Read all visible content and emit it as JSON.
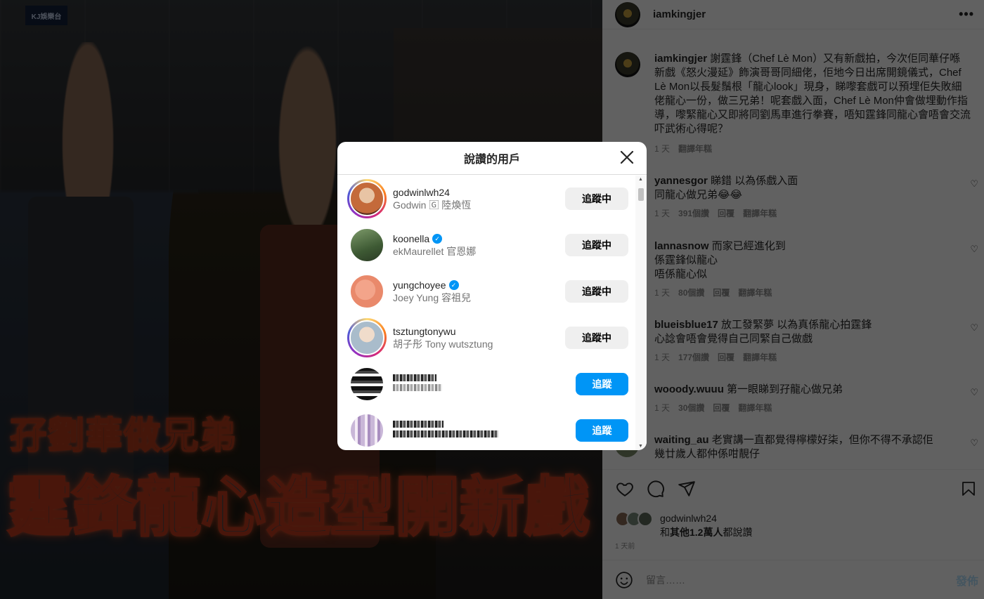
{
  "post": {
    "watermark": "KJ娛樂台",
    "headline_line1": "孖劉華做兄弟",
    "headline_line2": "霆鋒龍心造型開新戲"
  },
  "panel": {
    "author": "iamkingjer",
    "more_icon": "more-horizontal-icon",
    "caption": {
      "username": "iamkingjer",
      "text": "謝霆鋒（Chef Lè Mon）又有新戲拍，今次佢同華仔喺新戲《怒火漫延》飾演哥哥同細佬，佢地今日出席開鏡儀式，Chef Lè Mon以長髮鬚根「龍心look」現身，睇嚟套戲可以預埋佢失敗細佬龍心一份，做三兄弟！呢套戲入面，Chef Lè Mon仲會做埋動作指導，嚟緊龍心又即將同劉馬車進行拳賽，唔知霆鋒同龍心會唔會交流吓武術心得呢？",
      "time": "1 天",
      "translate": "翻譯年糕"
    },
    "comments": [
      {
        "user": "yannesgor",
        "text": "睇錯 以為係戲入面",
        "text2": "同龍心做兄弟😂😂",
        "time": "1 天",
        "likes": "391個讚",
        "reply": "回覆",
        "translate": "翻譯年糕"
      },
      {
        "user": "lannasnow",
        "text": "而家已經進化到",
        "text2": "係霆鋒似龍心",
        "text3": "唔係龍心似",
        "time": "1 天",
        "likes": "80個讚",
        "reply": "回覆",
        "translate": "翻譯年糕"
      },
      {
        "user": "blueisblue17",
        "text": "放工發緊夢 以為真係龍心拍霆鋒",
        "text2": "心諗會唔會覺得自己同緊自己做戲",
        "time": "1 天",
        "likes": "177個讚",
        "reply": "回覆",
        "translate": "翻譯年糕"
      },
      {
        "user": "wooody.wuuu",
        "text": "第一眼睇到孖龍心做兄弟",
        "time": "1 天",
        "likes": "30個讚",
        "reply": "回覆",
        "translate": "翻譯年糕"
      },
      {
        "user": "waiting_au",
        "text": "老實講一直都覺得檸檬好柒，但你不得不承認佢",
        "text2": "幾廿歲人都仲係咁靚仔"
      }
    ],
    "likes_line1": "godwinlwh24",
    "likes_line2_prefix": "和",
    "likes_line2_bold": "其他1.2萬人",
    "likes_line2_suffix": "都說讚",
    "posted_ago": "1 天前",
    "comment_placeholder": "留言……",
    "post_button": "發佈"
  },
  "modal": {
    "title": "說讚的用戶",
    "close_icon": "close-icon",
    "users": [
      {
        "handle": "godwinlwh24",
        "name": "Godwin 🄶 陸煥恆",
        "verified": false,
        "story": true,
        "button": "追蹤中",
        "button_style": "gray",
        "avatar_color": "#c46a3a"
      },
      {
        "handle": "koonella",
        "name": "ekMaurellet 官恩娜",
        "verified": true,
        "story": false,
        "button": "追蹤中",
        "button_style": "gray",
        "avatar_color": "#4f6b3e"
      },
      {
        "handle": "yungchoyee",
        "name": "Joey Yung 容祖兒",
        "verified": true,
        "story": false,
        "button": "追蹤中",
        "button_style": "gray",
        "avatar_color": "#e9896b"
      },
      {
        "handle": "tsztungtonywu",
        "name": "胡子彤 Tony wutsztung",
        "verified": false,
        "story": true,
        "button": "追蹤中",
        "button_style": "gray",
        "avatar_color": "#8fa5b8"
      },
      {
        "handle": "",
        "name": "",
        "verified": false,
        "story": false,
        "button": "追蹤",
        "button_style": "blue",
        "avatar_color": "#333333",
        "pixelated": true
      },
      {
        "handle": "",
        "name": "",
        "verified": false,
        "story": false,
        "button": "追蹤",
        "button_style": "blue",
        "avatar_color": "#c9b7d8",
        "pixelated": true
      }
    ]
  },
  "colors": {
    "follow_blue": "#0095f6",
    "following_gray": "#efefef",
    "headline_glow": "#d8461f"
  }
}
